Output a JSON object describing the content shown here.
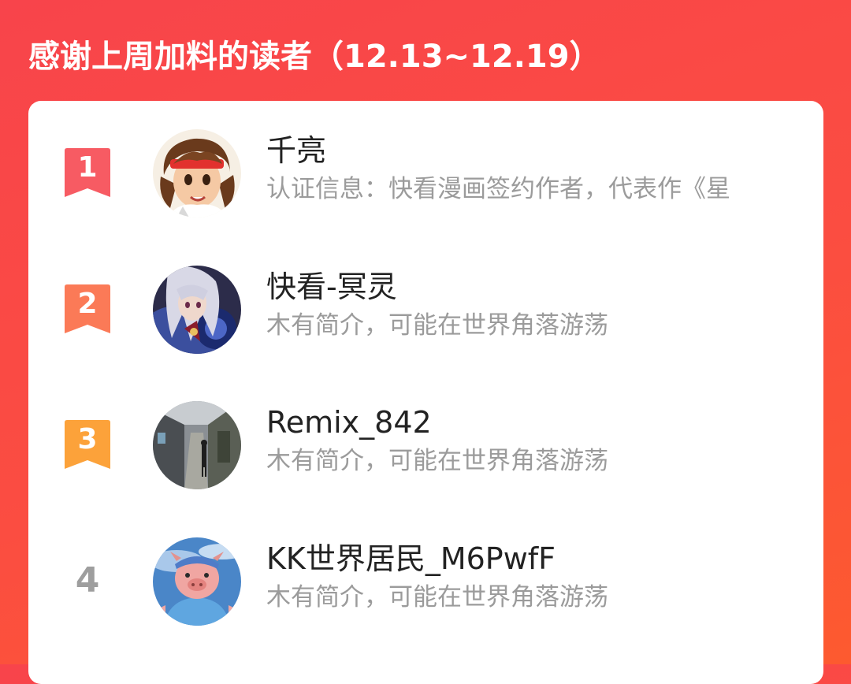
{
  "header": {
    "title": "感谢上周加料的读者（12.13~12.19）"
  },
  "colors": {
    "background": "#fb4a42",
    "rank1": "#f75b63",
    "rank2": "#fb7a57",
    "rank3": "#fca23a",
    "rank_plain": "#9e9e9e",
    "name": "#222222",
    "desc": "#9b9b9b"
  },
  "readers": [
    {
      "rank": "1",
      "name": "千亮",
      "desc": "认证信息：快看漫画签约作者，代表作《星",
      "avatar_icon": "anime-avatar-headband"
    },
    {
      "rank": "2",
      "name": "快看-冥灵",
      "desc": "木有简介，可能在世界角落游荡",
      "avatar_icon": "anime-avatar-silver-hair"
    },
    {
      "rank": "3",
      "name": "Remix_842",
      "desc": "木有简介，可能在世界角落游荡",
      "avatar_icon": "street-photo-avatar"
    },
    {
      "rank": "4",
      "name": "KK世界居民_M6PwfF",
      "desc": "木有简介，可能在世界角落游荡",
      "avatar_icon": "pig-character-avatar"
    }
  ]
}
